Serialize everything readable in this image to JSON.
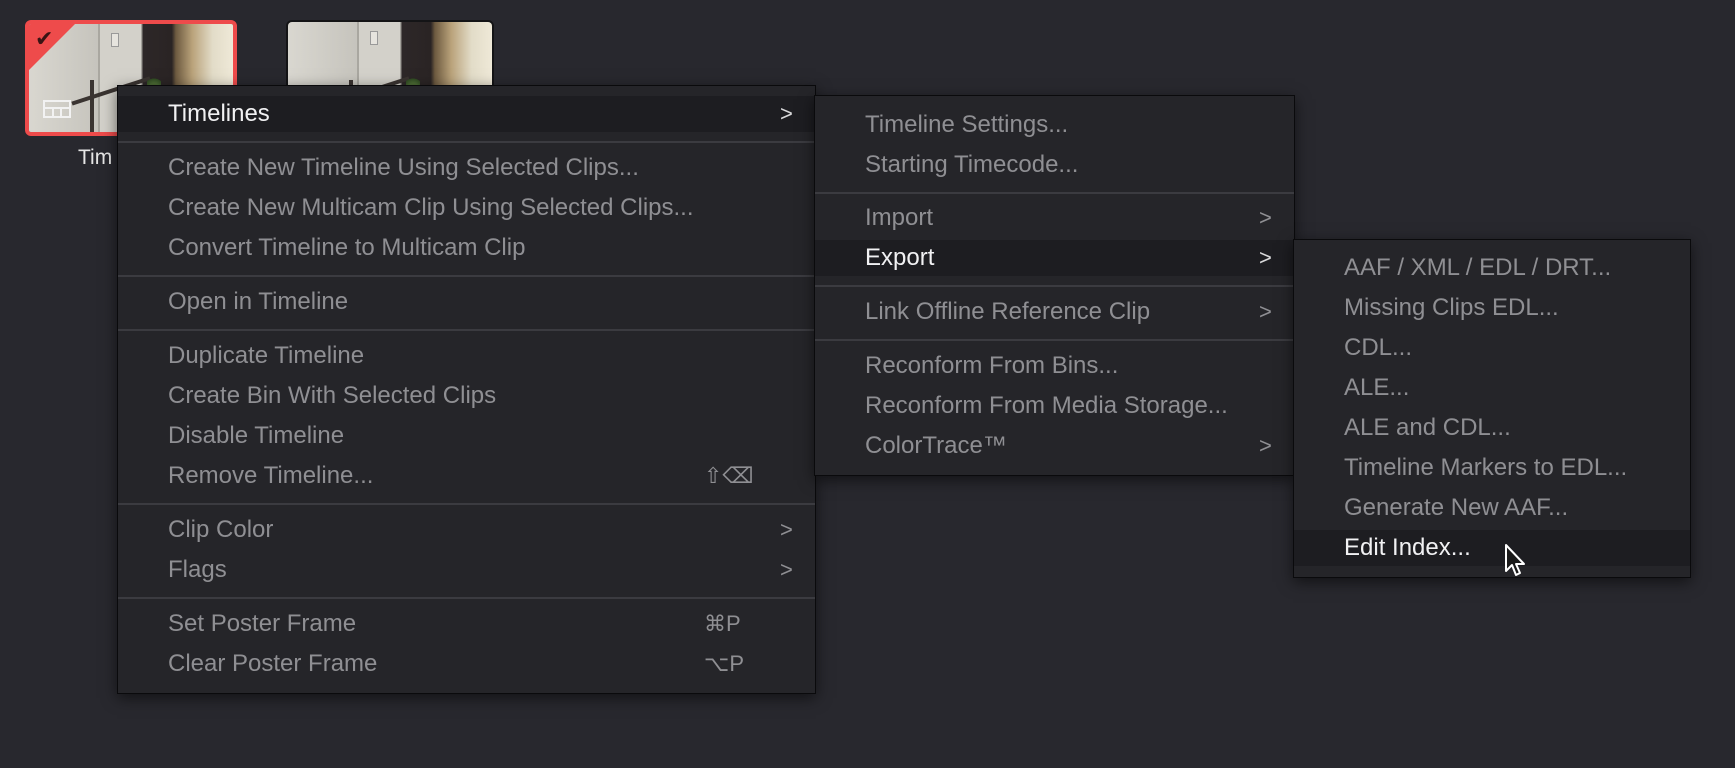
{
  "thumbnails": [
    {
      "name": "Tim",
      "selected": true
    },
    {
      "name": "",
      "selected": false
    }
  ],
  "icons": {
    "check": "✔",
    "timeline": "timeline-icon",
    "submenu_arrow": ">"
  },
  "menu": {
    "items": [
      {
        "label": "Timelines",
        "arrow": ">",
        "active": true
      },
      {
        "label": "Create New Timeline Using Selected Clips..."
      },
      {
        "label": "Create New Multicam Clip Using Selected Clips..."
      },
      {
        "label": "Convert Timeline to Multicam Clip"
      },
      {
        "label": "Open in Timeline"
      },
      {
        "label": "Duplicate Timeline"
      },
      {
        "label": "Create Bin With Selected Clips"
      },
      {
        "label": "Disable Timeline"
      },
      {
        "label": "Remove Timeline...",
        "shortcut": "⇧⌫"
      },
      {
        "label": "Clip Color",
        "arrow": ">"
      },
      {
        "label": "Flags",
        "arrow": ">"
      },
      {
        "label": "Set Poster Frame",
        "shortcut": "⌘P"
      },
      {
        "label": "Clear Poster Frame",
        "shortcut": "⌥P"
      }
    ]
  },
  "submenu_timelines": {
    "items": [
      {
        "label": "Timeline Settings..."
      },
      {
        "label": "Starting Timecode..."
      },
      {
        "label": "Import",
        "arrow": ">"
      },
      {
        "label": "Export",
        "arrow": ">",
        "active": true
      },
      {
        "label": "Link Offline Reference Clip",
        "arrow": ">"
      },
      {
        "label": "Reconform From Bins..."
      },
      {
        "label": "Reconform From Media Storage..."
      },
      {
        "label": "ColorTrace™",
        "arrow": ">"
      }
    ]
  },
  "submenu_export": {
    "items": [
      {
        "label": "AAF / XML / EDL / DRT..."
      },
      {
        "label": "Missing Clips EDL..."
      },
      {
        "label": "CDL..."
      },
      {
        "label": "ALE..."
      },
      {
        "label": "ALE and CDL..."
      },
      {
        "label": "Timeline Markers to EDL..."
      },
      {
        "label": "Generate New AAF..."
      },
      {
        "label": "Edit Index...",
        "active": true
      }
    ]
  },
  "colors": {
    "background": "#28282e",
    "menu_bg": "#252529",
    "active_bg": "#1d1d21",
    "selection_red": "#ee4b4b",
    "text_dim": "#8f8f93",
    "text_active": "#f1f1f3"
  }
}
